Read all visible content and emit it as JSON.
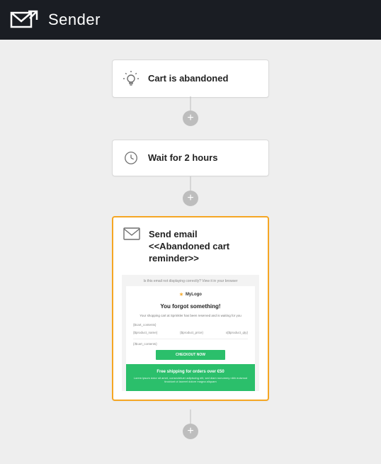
{
  "header": {
    "brand": "Sender"
  },
  "flow": {
    "trigger": {
      "label": "Cart is abandoned"
    },
    "delay": {
      "label": "Wait for 2 hours"
    },
    "email": {
      "label": "Send email <<Abandoned cart reminder>>",
      "preview": {
        "top_note": "Is this email not displaying correctly? View it in your browser",
        "logo_text": "MyLogo",
        "headline": "You forgot something!",
        "subhead": "Your shopping cart at Sprinkler has been reserved and is waiting for you",
        "placeholder_cart_top": "{$cart_contents}",
        "ph_name": "{$product_name}",
        "ph_price": "{$product_price}",
        "ph_qty": "x{$product_qty}",
        "placeholder_cart_bottom": "{/$cart_contents}",
        "cta": "CHECKOUT NOW",
        "banner_title": "Free shipping for orders over €50",
        "banner_sub": "Lorem ipsum dolor sit amet, consectetuer adipiscing elit, sed diam nonummy nibh euismod tincidunt ut laoreet dolore magna aliquam"
      }
    }
  }
}
